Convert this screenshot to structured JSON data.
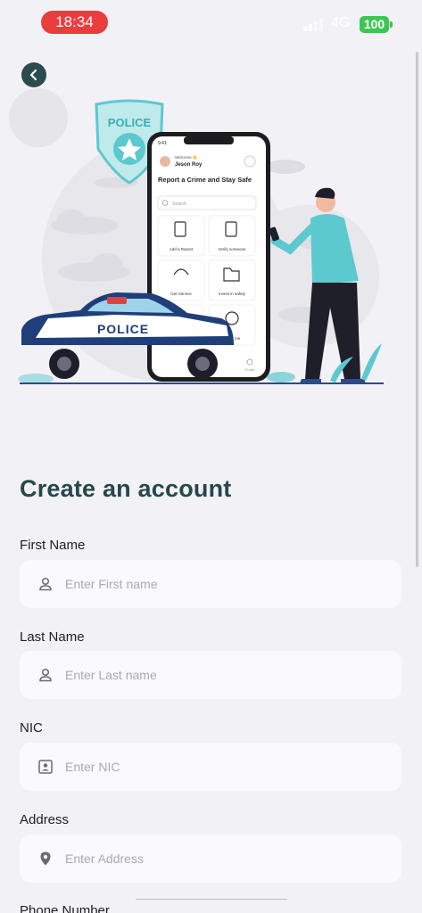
{
  "status_bar": {
    "time": "18:34",
    "network": "4G",
    "battery": "100"
  },
  "hero": {
    "badge_text": "POLICE",
    "car_text": "POLICE",
    "phone": {
      "time": "9:41",
      "welcome": "Welcome 👋",
      "user_name": "Jeson Roy",
      "headline": "Report a Crime and Stay Safe",
      "search_placeholder": "Search",
      "tiles": [
        "Add a Report",
        "Verify someone",
        "Get Service",
        "Invest in safety",
        "",
        "Track me"
      ],
      "nav_profile": "Profile"
    }
  },
  "page_title": "Create an account",
  "fields": {
    "first_name": {
      "label": "First Name",
      "placeholder": "Enter First name"
    },
    "last_name": {
      "label": "Last Name",
      "placeholder": "Enter Last name"
    },
    "nic": {
      "label": "NIC",
      "placeholder": "Enter NIC"
    },
    "address": {
      "label": "Address",
      "placeholder": "Enter Address"
    },
    "phone": {
      "label": "Phone Number"
    }
  },
  "colors": {
    "accent": "#26474b",
    "status_red": "#ea3d3d",
    "battery_green": "#3ec654",
    "illustration_teal": "#5cc9cf"
  }
}
